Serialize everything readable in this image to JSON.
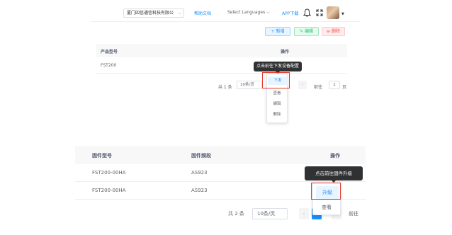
{
  "header": {
    "company": "厦门四信通信科技有限公",
    "help_docs": "帮助文档",
    "language": "Select Languages",
    "app_download": "APP下载"
  },
  "toolbar": {
    "add_label": "+ 新增",
    "edit_label": "✎ 编辑",
    "delete_label": "⊖ 删除"
  },
  "product_table": {
    "headers": [
      "产品型号",
      "操作"
    ],
    "rows": [
      {
        "model": "FST200"
      }
    ],
    "tooltip": "点击前往下发设备配置",
    "menu": [
      "下发",
      "查看",
      "编辑",
      "删除"
    ],
    "pagination": {
      "total": "共 1 条",
      "page_size": "10条/页",
      "goto_label": "前往",
      "goto_value": "1",
      "page_suffix": "页",
      "next": "›"
    }
  },
  "firmware_table": {
    "headers": [
      "固件型号",
      "固件频段",
      "操作"
    ],
    "rows": [
      {
        "model": "FST200-00HA",
        "band": "AS923"
      },
      {
        "model": "FST200-00HA",
        "band": "AS923"
      }
    ],
    "tooltip": "点击前往固件升级",
    "menu": [
      "升级",
      "查看"
    ],
    "pagination": {
      "total": "共 2 条",
      "page_size": "10条/页",
      "prev": "‹",
      "next": "›",
      "goto_label": "前往"
    }
  },
  "colors": {
    "primary": "#1890ff",
    "highlight": "#e6352b",
    "tooltip_bg": "#303133",
    "success": "#13ce66",
    "danger": "#ff4949"
  }
}
